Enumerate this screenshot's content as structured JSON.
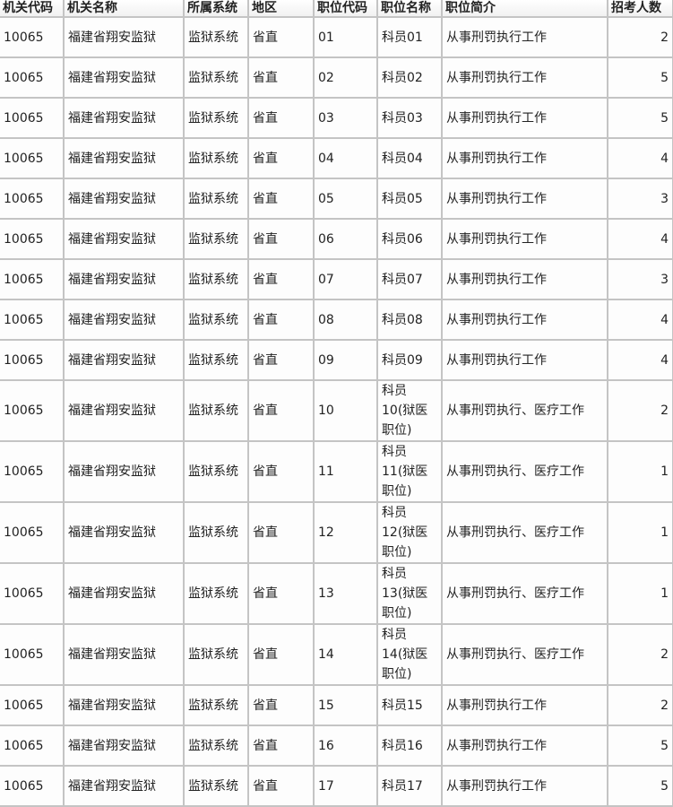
{
  "table": {
    "headers": [
      "机关代码",
      "机关名称",
      "所属系统",
      "地区",
      "职位代码",
      "职位名称",
      "职位简介",
      "招考人数"
    ],
    "rows": [
      {
        "org_code": "10065",
        "org_name": "福建省翔安监狱",
        "system": "监狱系统",
        "region": "省直",
        "pos_code": "01",
        "pos_name": "科员01",
        "desc": "从事刑罚执行工作",
        "count": "2"
      },
      {
        "org_code": "10065",
        "org_name": "福建省翔安监狱",
        "system": "监狱系统",
        "region": "省直",
        "pos_code": "02",
        "pos_name": "科员02",
        "desc": "从事刑罚执行工作",
        "count": "5"
      },
      {
        "org_code": "10065",
        "org_name": "福建省翔安监狱",
        "system": "监狱系统",
        "region": "省直",
        "pos_code": "03",
        "pos_name": "科员03",
        "desc": "从事刑罚执行工作",
        "count": "5"
      },
      {
        "org_code": "10065",
        "org_name": "福建省翔安监狱",
        "system": "监狱系统",
        "region": "省直",
        "pos_code": "04",
        "pos_name": "科员04",
        "desc": "从事刑罚执行工作",
        "count": "4"
      },
      {
        "org_code": "10065",
        "org_name": "福建省翔安监狱",
        "system": "监狱系统",
        "region": "省直",
        "pos_code": "05",
        "pos_name": "科员05",
        "desc": "从事刑罚执行工作",
        "count": "3"
      },
      {
        "org_code": "10065",
        "org_name": "福建省翔安监狱",
        "system": "监狱系统",
        "region": "省直",
        "pos_code": "06",
        "pos_name": "科员06",
        "desc": "从事刑罚执行工作",
        "count": "4"
      },
      {
        "org_code": "10065",
        "org_name": "福建省翔安监狱",
        "system": "监狱系统",
        "region": "省直",
        "pos_code": "07",
        "pos_name": "科员07",
        "desc": "从事刑罚执行工作",
        "count": "3"
      },
      {
        "org_code": "10065",
        "org_name": "福建省翔安监狱",
        "system": "监狱系统",
        "region": "省直",
        "pos_code": "08",
        "pos_name": "科员08",
        "desc": "从事刑罚执行工作",
        "count": "4"
      },
      {
        "org_code": "10065",
        "org_name": "福建省翔安监狱",
        "system": "监狱系统",
        "region": "省直",
        "pos_code": "09",
        "pos_name": "科员09",
        "desc": "从事刑罚执行工作",
        "count": "4"
      },
      {
        "org_code": "10065",
        "org_name": "福建省翔安监狱",
        "system": "监狱系统",
        "region": "省直",
        "pos_code": "10",
        "pos_name": "科员10(狱医职位)",
        "desc": "从事刑罚执行、医疗工作",
        "count": "2"
      },
      {
        "org_code": "10065",
        "org_name": "福建省翔安监狱",
        "system": "监狱系统",
        "region": "省直",
        "pos_code": "11",
        "pos_name": "科员11(狱医职位)",
        "desc": "从事刑罚执行、医疗工作",
        "count": "1"
      },
      {
        "org_code": "10065",
        "org_name": "福建省翔安监狱",
        "system": "监狱系统",
        "region": "省直",
        "pos_code": "12",
        "pos_name": "科员12(狱医职位)",
        "desc": "从事刑罚执行、医疗工作",
        "count": "1"
      },
      {
        "org_code": "10065",
        "org_name": "福建省翔安监狱",
        "system": "监狱系统",
        "region": "省直",
        "pos_code": "13",
        "pos_name": "科员13(狱医职位)",
        "desc": "从事刑罚执行、医疗工作",
        "count": "1"
      },
      {
        "org_code": "10065",
        "org_name": "福建省翔安监狱",
        "system": "监狱系统",
        "region": "省直",
        "pos_code": "14",
        "pos_name": "科员14(狱医职位)",
        "desc": "从事刑罚执行、医疗工作",
        "count": "2"
      },
      {
        "org_code": "10065",
        "org_name": "福建省翔安监狱",
        "system": "监狱系统",
        "region": "省直",
        "pos_code": "15",
        "pos_name": "科员15",
        "desc": "从事刑罚执行工作",
        "count": "2"
      },
      {
        "org_code": "10065",
        "org_name": "福建省翔安监狱",
        "system": "监狱系统",
        "region": "省直",
        "pos_code": "16",
        "pos_name": "科员16",
        "desc": "从事刑罚执行工作",
        "count": "5"
      },
      {
        "org_code": "10065",
        "org_name": "福建省翔安监狱",
        "system": "监狱系统",
        "region": "省直",
        "pos_code": "17",
        "pos_name": "科员17",
        "desc": "从事刑罚执行工作",
        "count": "5"
      }
    ]
  }
}
